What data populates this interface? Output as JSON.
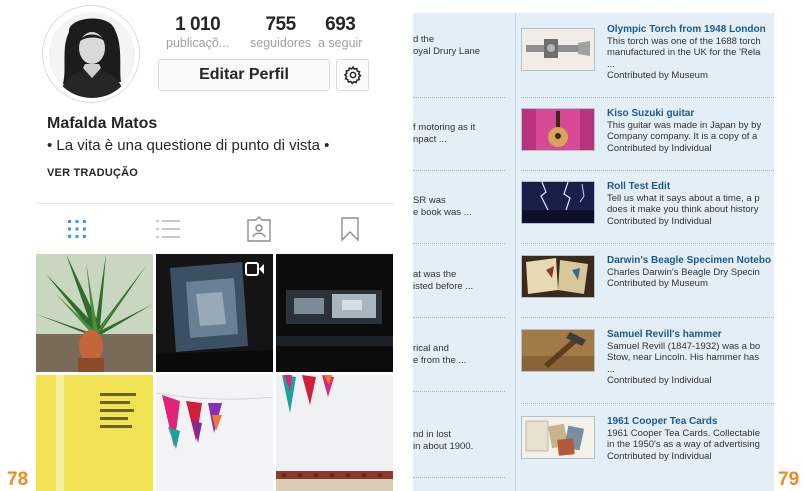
{
  "left_page": {
    "stats": [
      {
        "value": "1 010",
        "label": "publicaçõ..."
      },
      {
        "value": "755",
        "label": "seguidores"
      },
      {
        "value": "693",
        "label": "a seguir"
      }
    ],
    "edit_button": "Editar Perfil",
    "gear_icon": "gear-icon",
    "profile_name": "Mafalda Matos",
    "bio": "• La vita è una questione di punto di vista •",
    "translate_link": "VER TRADUÇÃO",
    "tabs": [
      "grid-icon",
      "list-icon",
      "tagged-icon",
      "bookmark-icon"
    ],
    "page_number": "78"
  },
  "right_page": {
    "fragments": [
      {
        "lines": [
          "d the",
          "oyal Drury Lane"
        ]
      },
      {
        "lines": [
          "f motoring as it",
          "npact ..."
        ]
      },
      {
        "lines": [
          "SR was",
          "e book was ..."
        ]
      },
      {
        "lines": [
          "at was the",
          "isted before ..."
        ]
      },
      {
        "lines": [
          "rical and",
          "e from the ..."
        ]
      },
      {
        "lines": [
          "nd in lost",
          "in about 1900."
        ]
      }
    ],
    "items": [
      {
        "title": "Olympic Torch from 1948 London",
        "lines": [
          "This torch was one of the 1688 torch",
          "manufactured in the UK for the 'Rela",
          "..."
        ],
        "contributor": "Contributed by Museum"
      },
      {
        "title": "Kiso Suzuki guitar",
        "lines": [
          "This guitar was made in Japan by by",
          "Company company. It is a copy of a"
        ],
        "contributor": "Contributed by Individual"
      },
      {
        "title": "Roll Test Edit",
        "lines": [
          "Tell us what it says about a time, a p",
          "does it make you think about history"
        ],
        "contributor": "Contributed by Individual"
      },
      {
        "title": "Darwin's Beagle Specimen Notebo",
        "lines": [
          "Charles Darwin's Beagle Dry Specin"
        ],
        "contributor": "Contributed by Museum"
      },
      {
        "title": "Samuel Revill's hammer",
        "lines": [
          "Samuel Revill (1847-1932) was a bo",
          "Stow, near Lincoln. His hammer has",
          "..."
        ],
        "contributor": "Contributed by Individual"
      },
      {
        "title": "1961 Cooper Tea Cards",
        "lines": [
          "1961 Cooper Tea Cards. Collectable",
          "in the 1950's as a way of advertising"
        ],
        "contributor": "Contributed by Individual"
      }
    ],
    "page_number": "79"
  }
}
